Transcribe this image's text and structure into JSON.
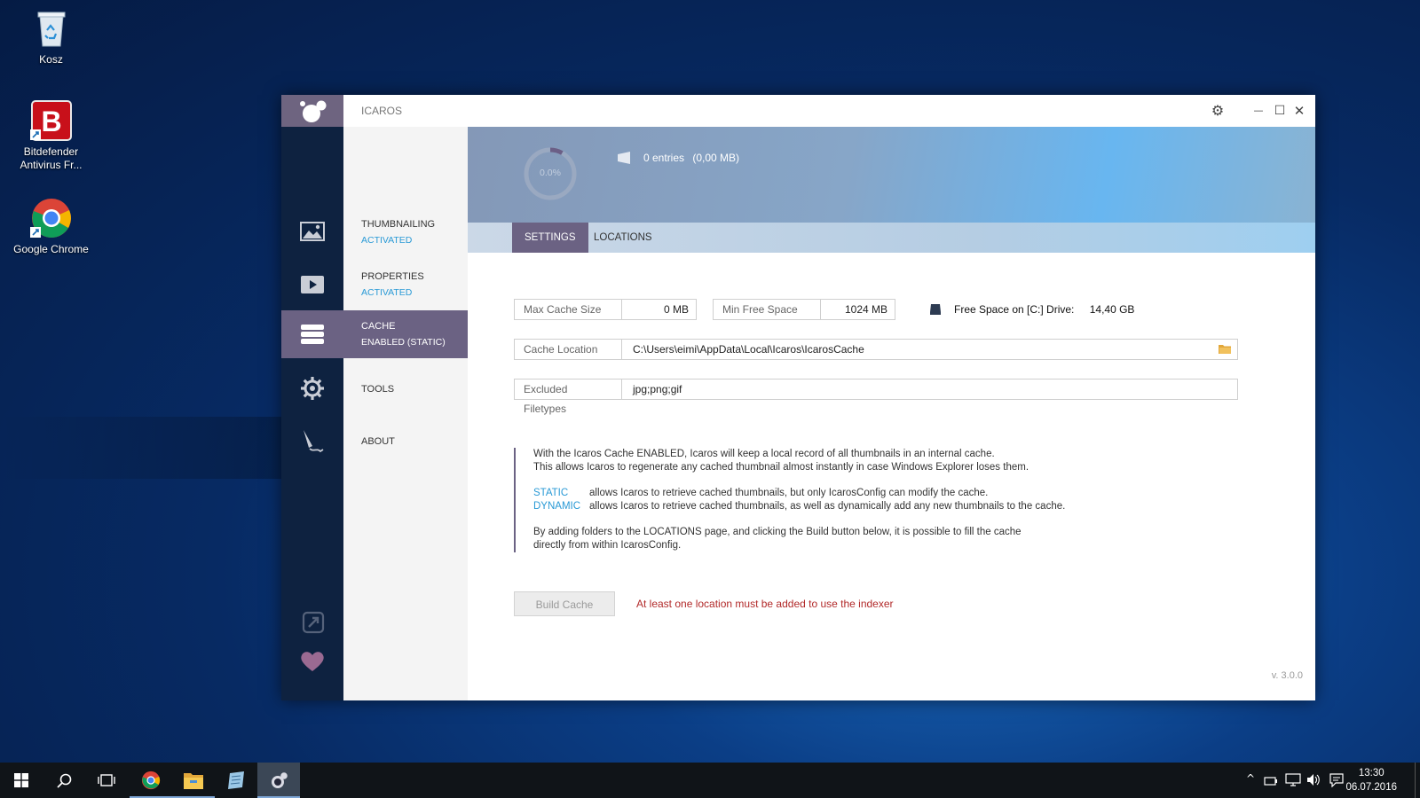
{
  "desktop": {
    "icons": [
      {
        "label": "Kosz"
      },
      {
        "label": "Bitdefender\nAntivirus Fr..."
      },
      {
        "label": "Google Chrome"
      }
    ]
  },
  "window": {
    "title": "ICAROS",
    "controls": {
      "settings": "⚙",
      "minimize": "—",
      "maximize": "☐",
      "close": "✕"
    }
  },
  "nav": [
    {
      "label": "THUMBNAILING",
      "status": "ACTIVATED",
      "icon": "image-icon"
    },
    {
      "label": "PROPERTIES",
      "status": "ACTIVATED",
      "icon": "video-icon"
    },
    {
      "label": "CACHE",
      "status": "ENABLED (STATIC)",
      "icon": "database-icon",
      "active": true
    },
    {
      "label": "TOOLS",
      "status": "",
      "icon": "gear-icon"
    },
    {
      "label": "ABOUT",
      "status": "",
      "icon": "quill-icon"
    }
  ],
  "banner": {
    "progress_text": "0.0%",
    "progress_fraction": 0.0,
    "entries": "0 entries",
    "size": "(0,00 MB)"
  },
  "tabs": [
    "SETTINGS",
    "LOCATIONS"
  ],
  "settings": {
    "max_cache_label": "Max Cache Size",
    "max_cache_value": "0 MB",
    "min_free_label": "Min Free Space",
    "min_free_value": "1024 MB",
    "free_space_label": "Free Space on [C:] Drive:",
    "free_space_value": "14,40 GB",
    "cache_location_label": "Cache Location",
    "cache_location_value": "C:\\Users\\eimi\\AppData\\Local\\Icaros\\IcarosCache",
    "excluded_label": "Excluded Filetypes",
    "excluded_value": "jpg;png;gif"
  },
  "info": {
    "line1": "With the Icaros Cache ENABLED, Icaros will keep a local record of all thumbnails in an internal cache.",
    "line2": "This allows Icaros to regenerate any cached thumbnail almost instantly in case Windows Explorer loses them.",
    "static_kw": "STATIC",
    "static_desc": "allows Icaros to retrieve cached thumbnails, but only IcarosConfig can modify the cache.",
    "dynamic_kw": "DYNAMIC",
    "dynamic_desc": "allows Icaros to retrieve cached thumbnails, as well as dynamically add any new thumbnails to the cache.",
    "line3": "By adding folders to the LOCATIONS page, and clicking the Build button below, it is possible to fill the cache",
    "line4": "directly from within IcarosConfig."
  },
  "build": {
    "button": "Build Cache",
    "warning": "At least one location must be added to use the indexer"
  },
  "version": "v. 3.0.0",
  "taskbar": {
    "time": "13:30",
    "date": "06.07.2016"
  },
  "colors": {
    "accent": "#6b6283",
    "link": "#2a9ad6",
    "warning": "#b22a2a",
    "sidebar": "#0e2240"
  }
}
